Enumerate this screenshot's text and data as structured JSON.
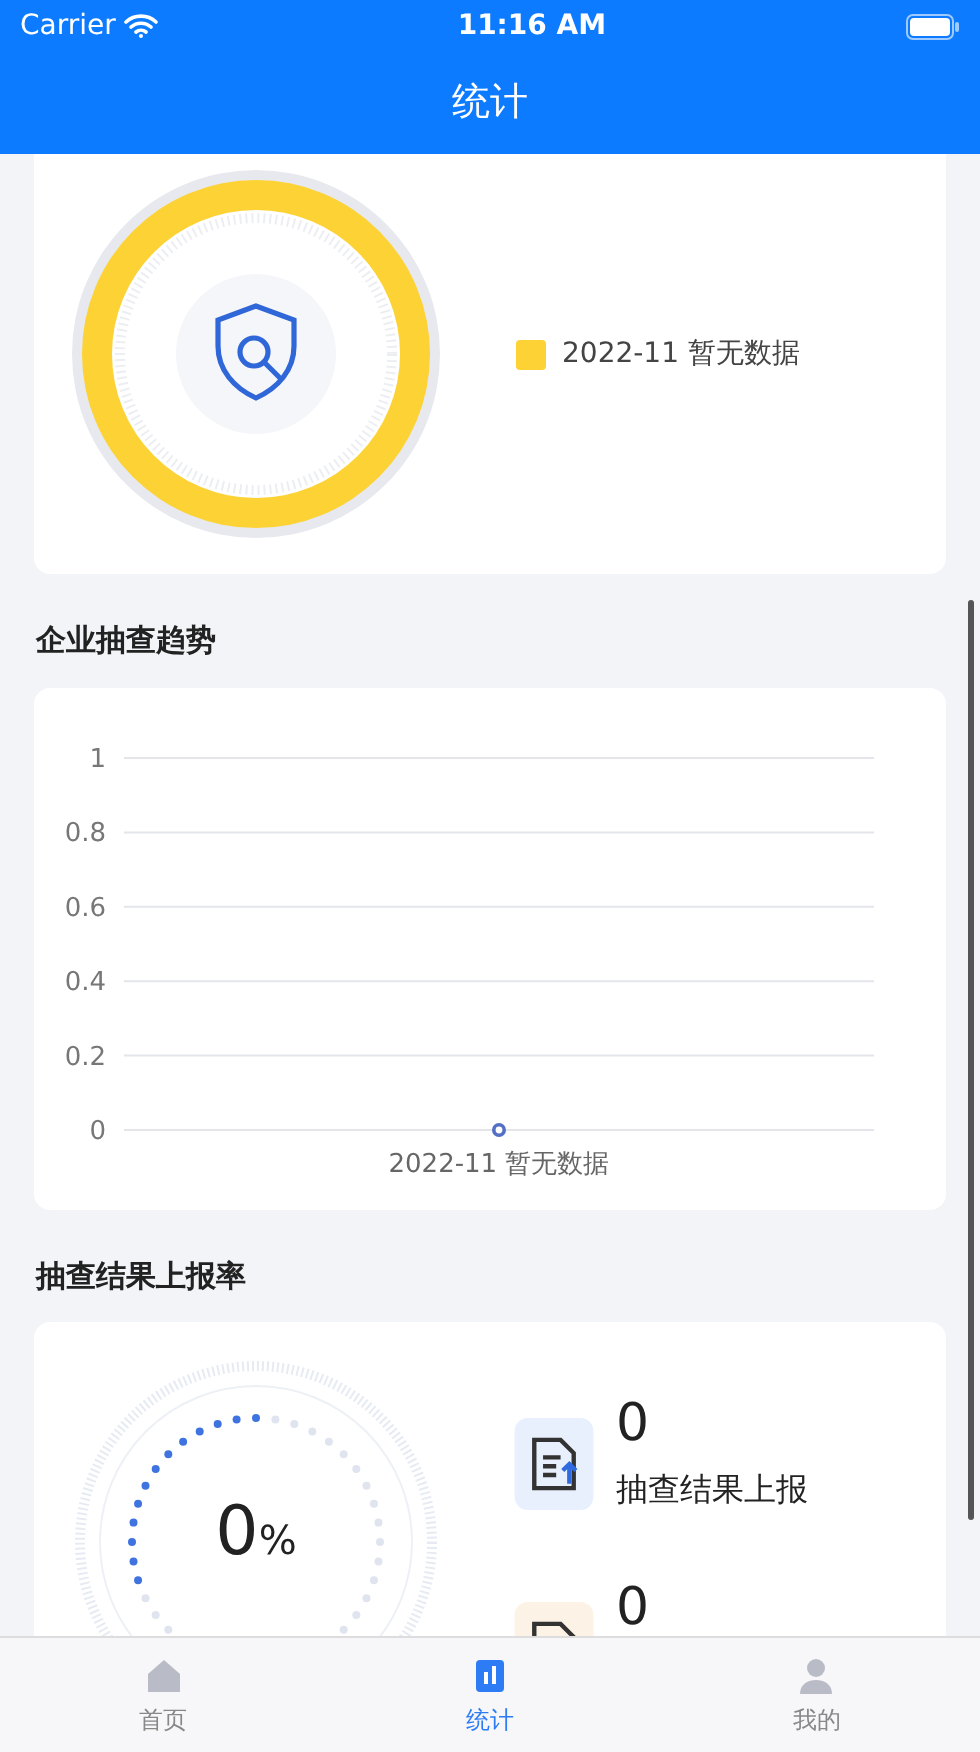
{
  "status_bar": {
    "carrier": "Carrier",
    "time": "11:16 AM"
  },
  "nav_bar": {
    "title": "统计"
  },
  "overview": {
    "legend": [
      {
        "label": "2022-11 暂无数据",
        "color": "#fdd235"
      }
    ]
  },
  "trend": {
    "title": "企业抽查趋势",
    "chart_data": {
      "type": "line",
      "categories": [
        "2022-11 暂无数据"
      ],
      "series": [
        {
          "color": "#5470c6",
          "marker": true,
          "values": [
            0
          ]
        }
      ],
      "grid": true,
      "ylim": [
        0,
        1
      ],
      "yticks": [
        0,
        0.2,
        0.4,
        0.6,
        0.8,
        1
      ]
    }
  },
  "report_rate": {
    "title": "抽查结果上报率",
    "percent": "0",
    "unit": "%",
    "stats": [
      {
        "kind": "reported",
        "value": "0",
        "label": "抽查结果上报"
      },
      {
        "kind": "pending",
        "value": "0"
      }
    ]
  },
  "tabs": [
    {
      "kind": "home",
      "label": "首页",
      "selected": false
    },
    {
      "kind": "stats",
      "label": "统计",
      "selected": true
    },
    {
      "kind": "profile",
      "label": "我的",
      "selected": false
    }
  ]
}
